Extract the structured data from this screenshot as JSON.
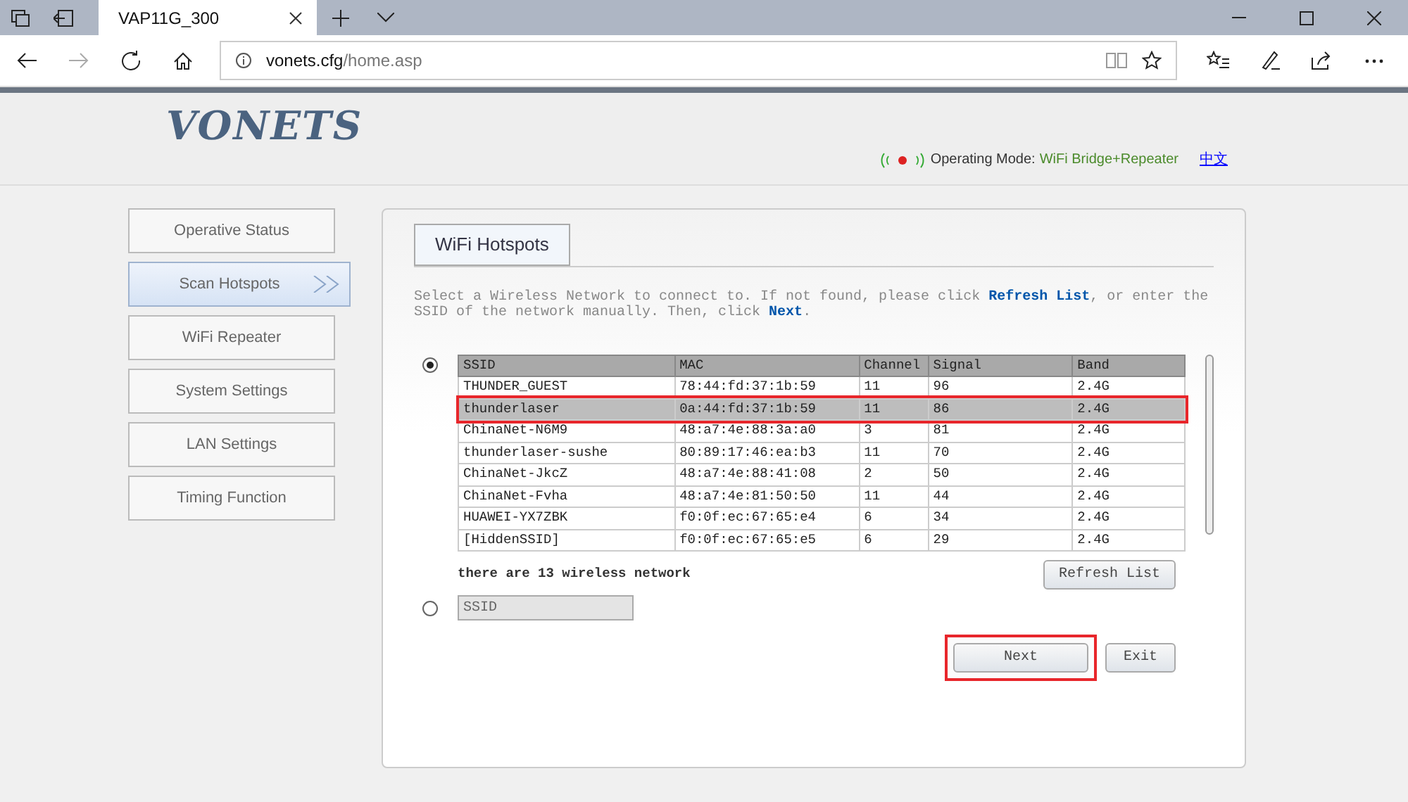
{
  "browser": {
    "tab_title": "VAP11G_300",
    "url_host": "vonets.cfg",
    "url_path": "/home.asp"
  },
  "header": {
    "logo": "VONETS",
    "operating_mode_label": "Operating Mode:",
    "operating_mode_value": "WiFi Bridge+Repeater",
    "language_link": "中文"
  },
  "sidebar": {
    "items": [
      {
        "label": "Operative Status",
        "selected": false
      },
      {
        "label": "Scan Hotspots",
        "selected": true
      },
      {
        "label": "WiFi Repeater",
        "selected": false
      },
      {
        "label": "System Settings",
        "selected": false
      },
      {
        "label": "LAN Settings",
        "selected": false
      },
      {
        "label": "Timing Function",
        "selected": false
      }
    ]
  },
  "panel": {
    "tab": "WiFi Hotspots",
    "instruction": "Select a Wireless Network to connect to. If not found, please click **Refresh List**, or enter the SSID of the network manually. Then, click **Next**.",
    "scan_option": {
      "selected": true
    },
    "table": {
      "columns": [
        "SSID",
        "MAC",
        "Channel",
        "Signal",
        "Band"
      ],
      "rows": [
        {
          "cells": [
            "THUNDER_GUEST",
            "78:44:fd:37:1b:59",
            "11",
            "96",
            "2.4G"
          ],
          "selected": false
        },
        {
          "cells": [
            "thunderlaser",
            "0a:44:fd:37:1b:59",
            "11",
            "86",
            "2.4G"
          ],
          "selected": true
        },
        {
          "cells": [
            "ChinaNet-N6M9",
            "48:a7:4e:88:3a:a0",
            "3",
            "81",
            "2.4G"
          ],
          "selected": false
        },
        {
          "cells": [
            "thunderlaser-sushe",
            "80:89:17:46:ea:b3",
            "11",
            "70",
            "2.4G"
          ],
          "selected": false
        },
        {
          "cells": [
            "ChinaNet-JkcZ",
            "48:a7:4e:88:41:08",
            "2",
            "50",
            "2.4G"
          ],
          "selected": false
        },
        {
          "cells": [
            "ChinaNet-Fvha",
            "48:a7:4e:81:50:50",
            "11",
            "44",
            "2.4G"
          ],
          "selected": false
        },
        {
          "cells": [
            "HUAWEI-YX7ZBK",
            "f0:0f:ec:67:65:e4",
            "6",
            "34",
            "2.4G"
          ],
          "selected": false
        },
        {
          "cells": [
            "[HiddenSSID]",
            "f0:0f:ec:67:65:e5",
            "6",
            "29",
            "2.4G"
          ],
          "selected": false
        }
      ]
    },
    "network_count": "there are 13 wireless network",
    "refresh_button": "Refresh List",
    "manual_option": {
      "selected": false
    },
    "ssid_field": {
      "placeholder": "SSID",
      "disabled": true
    },
    "buttons": [
      {
        "label": "Next",
        "highlighted": true
      },
      {
        "label": "Exit",
        "highlighted": false
      }
    ]
  }
}
